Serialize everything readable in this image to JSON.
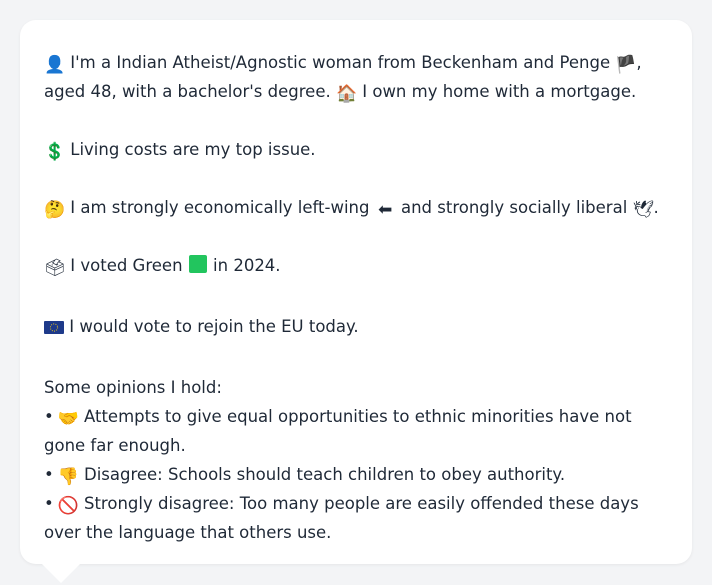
{
  "profile": {
    "intro_icon": "👤",
    "intro_text_1": "I'm a Indian Atheist/Agnostic woman from Beckenham and Penge",
    "intro_flag_icon": "🏴",
    "intro_text_2": ", aged 48, with a bachelor's degree.",
    "home_icon": "🏠",
    "home_text": "I own my home with a mortgage.",
    "issue_icon": "💲",
    "issue_text": "Living costs are my top issue.",
    "ideology_icon": "🤔",
    "ideology_text_1": "I am strongly economically left-wing",
    "left_arrow_icon": "⬅",
    "ideology_text_2": "and strongly socially liberal",
    "dove_icon": "🕊",
    "ideology_text_3": ".",
    "ballot_icon": "🗳",
    "vote_text_1": "I voted Green",
    "green_square_icon": "🟩",
    "vote_text_2": "in 2024.",
    "eu_icon": "🇪🇺",
    "eu_text": "I would vote to rejoin the EU today.",
    "opinions_heading": "Some opinions I hold:",
    "bullet": "•",
    "opinions": [
      {
        "icon": "🤝",
        "text": "Attempts to give equal opportunities to ethnic minorities have not gone far enough."
      },
      {
        "icon": "👎",
        "text": "Disagree: Schools should teach children to obey authority."
      },
      {
        "icon": "🚫",
        "text": "Strongly disagree: Too many people are easily offended these days over the language that others use."
      }
    ]
  },
  "colors": {
    "background": "#f3f4f6",
    "bubble": "#ffffff",
    "text": "#1f2937",
    "green_square": "#22c55e",
    "eu_blue": "#1e3a8a"
  }
}
